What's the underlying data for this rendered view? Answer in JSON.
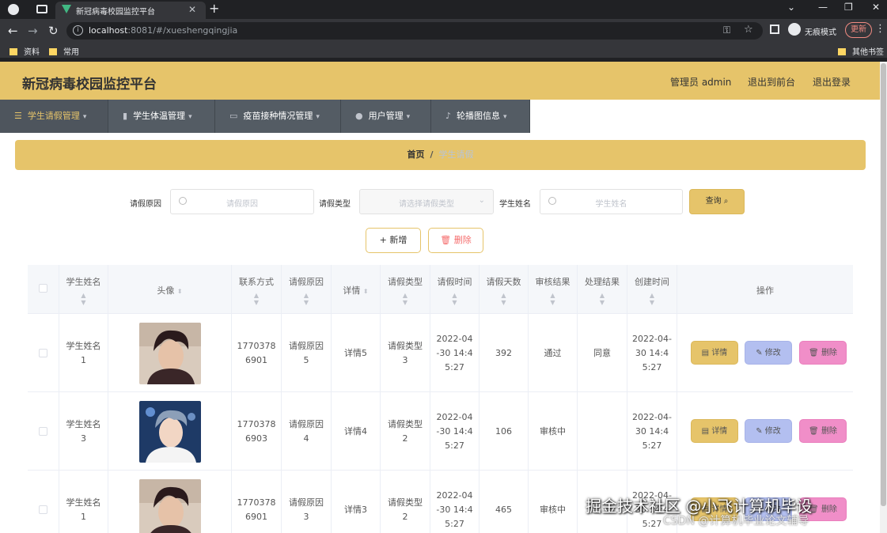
{
  "browser": {
    "tab_title": "新冠病毒校园监控平台",
    "url_host": "localhost",
    "url_path": ":8081/#/xueshengqingjia",
    "incognito_label": "无痕模式",
    "update_label": "更新",
    "bookmarks": [
      "资料",
      "常用"
    ],
    "other_bookmarks": "其他书签"
  },
  "header": {
    "title": "新冠病毒校园监控平台",
    "admin": "管理员 admin",
    "front": "退出到前台",
    "logout": "退出登录"
  },
  "menu": [
    {
      "label": "学生请假管理",
      "icon": "list-icon",
      "active": true
    },
    {
      "label": "学生体温管理",
      "icon": "bar-chart-icon",
      "active": false
    },
    {
      "label": "疫苗接种情况管理",
      "icon": "message-icon",
      "active": false
    },
    {
      "label": "用户管理",
      "icon": "location-icon",
      "active": false
    },
    {
      "label": "轮播图信息",
      "icon": "microphone-icon",
      "active": false
    }
  ],
  "breadcrumb": {
    "home": "首页",
    "separator": "/",
    "current": "学生请假"
  },
  "search": {
    "reason_label": "请假原因",
    "reason_placeholder": "请假原因",
    "type_label": "请假类型",
    "type_placeholder": "请选择请假类型",
    "name_label": "学生姓名",
    "name_placeholder": "学生姓名",
    "query_label": "查询"
  },
  "actions": {
    "add_label": "新增",
    "delete_label": "删除"
  },
  "table": {
    "headers": {
      "name": "学生姓名",
      "avatar": "头像",
      "phone": "联系方式",
      "reason": "请假原因",
      "detail": "详情",
      "type": "请假类型",
      "time": "请假时间",
      "days": "请假天数",
      "audit": "审核结果",
      "result": "处理结果",
      "created": "创建时间",
      "ops": "操作"
    },
    "rows": [
      {
        "name": "学生姓名1",
        "phone": "17703786901",
        "reason": "请假原因5",
        "detail": "详情5",
        "type": "请假类型3",
        "time": "2022-04-30 14:45:27",
        "days": "392",
        "audit": "通过",
        "result": "同意",
        "created": "2022-04-30 14:45:27"
      },
      {
        "name": "学生姓名3",
        "phone": "17703786903",
        "reason": "请假原因4",
        "detail": "详情4",
        "type": "请假类型2",
        "time": "2022-04-30 14:45:27",
        "days": "106",
        "audit": "审核中",
        "result": "",
        "created": "2022-04-30 14:45:27"
      },
      {
        "name": "学生姓名1",
        "phone": "17703786901",
        "reason": "请假原因3",
        "detail": "详情3",
        "type": "请假类型2",
        "time": "2022-04-30 14:45:27",
        "days": "465",
        "audit": "审核中",
        "result": "",
        "created": "2022-04-30 14:45:27"
      }
    ],
    "row_buttons": {
      "detail": "详情",
      "edit": "修改",
      "delete": "删除"
    }
  },
  "watermark": {
    "line1": "掘金技术社区 @小飞计算机毕设",
    "line2": "CSDN @计算机毕业论文辅导"
  },
  "colors": {
    "accent": "#e6c46a",
    "menu_bg": "#545c64",
    "edit_btn": "#b3bff0",
    "delete_btn": "#f08ec8",
    "danger_text": "#f56c6c"
  }
}
